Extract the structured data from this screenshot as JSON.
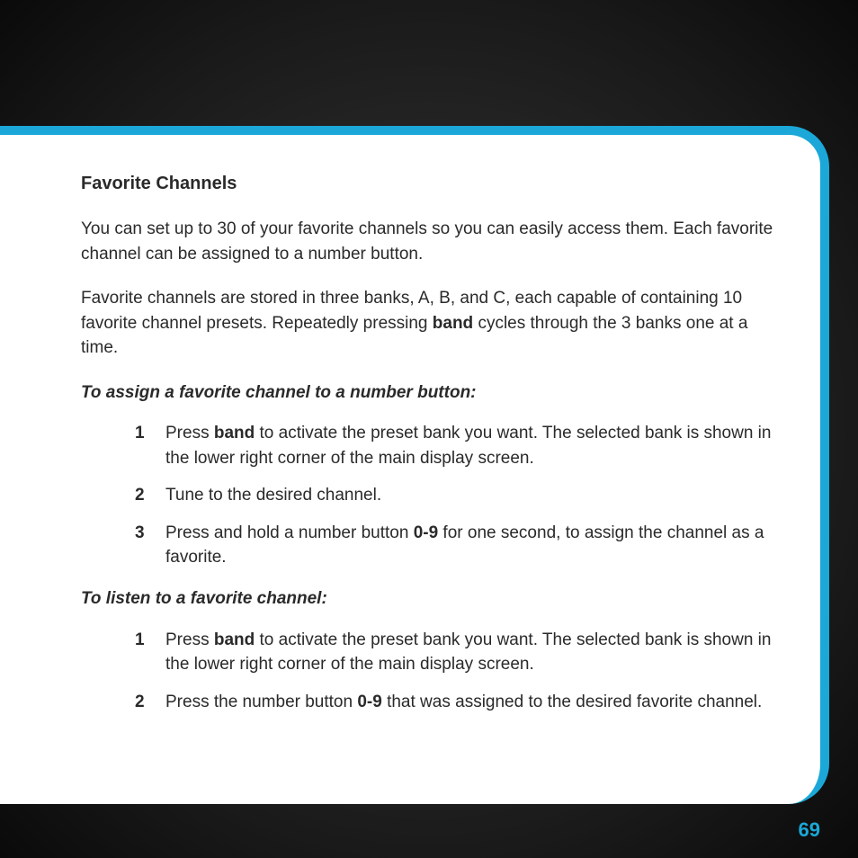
{
  "title": "Favorite Channels",
  "intro1": "You can set up to 30 of your favorite channels so you can easily access them. Each favorite channel can be assigned to a number button.",
  "intro2_a": "Favorite channels are stored in three banks, A, B, and C, each capable of containing 10 favorite channel presets. Repeatedly pressing ",
  "intro2_bold": "band",
  "intro2_b": " cycles through the 3 banks one at a time.",
  "sub1": "To assign a favorite channel to a number button:",
  "assign": [
    {
      "num": "1",
      "pre": "Press ",
      "b1": "band",
      "post": " to activate the preset bank you want. The selected bank is shown in the lower right corner of the main display screen."
    },
    {
      "num": "2",
      "pre": "Tune to the desired channel.",
      "b1": "",
      "post": ""
    },
    {
      "num": "3",
      "pre": "Press and hold a number button ",
      "b1": "0-9",
      "post": " for one second, to assign the channel as a favorite."
    }
  ],
  "sub2": "To listen to a favorite channel:",
  "listen": [
    {
      "num": "1",
      "pre": "Press ",
      "b1": "band",
      "post": " to activate the preset bank you want. The selected bank is shown in the lower right corner of the main display screen."
    },
    {
      "num": "2",
      "pre": "Press the number button ",
      "b1": "0-9",
      "post": " that was assigned to the desired favorite channel."
    }
  ],
  "page_number": "69"
}
